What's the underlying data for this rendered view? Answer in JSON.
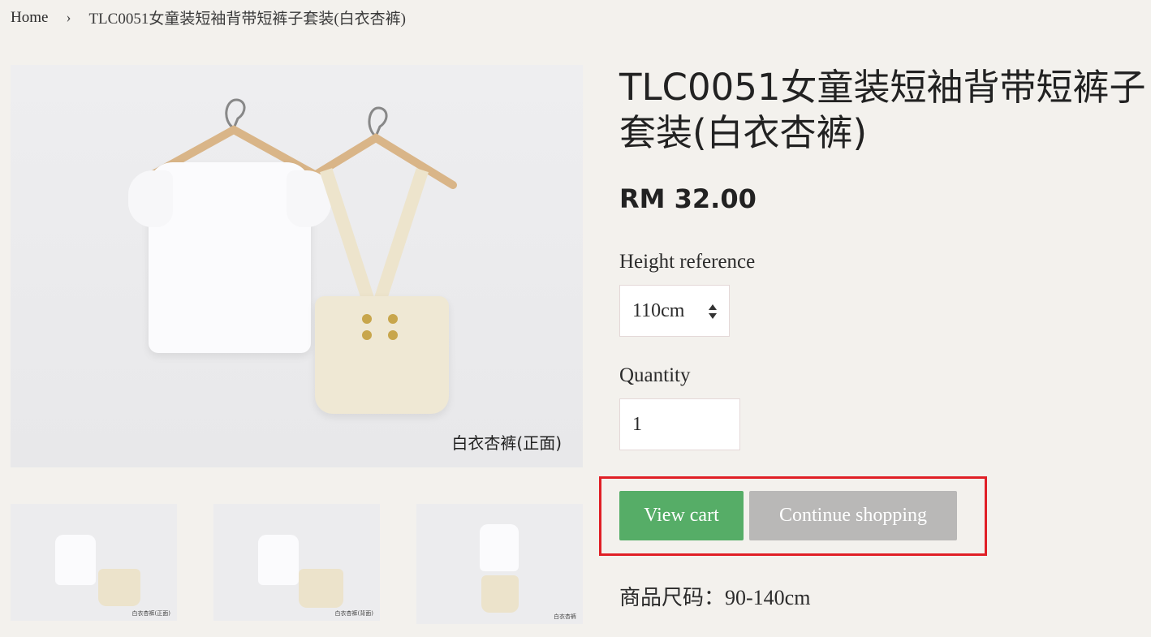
{
  "breadcrumb": {
    "home": "Home",
    "separator": "›",
    "current": "TLC0051女童装短袖背带短裤子套装(白衣杏裤)"
  },
  "gallery": {
    "main_caption": "白衣杏裤(正面)",
    "thumbnails": [
      {
        "caption": "白衣杏裤(正面)"
      },
      {
        "caption": "白衣杏裤(背面)"
      },
      {
        "caption": "白衣杏裤"
      }
    ]
  },
  "product": {
    "title_line1": "TLC0051女童装短袖背带短裤子",
    "title_line2": "套装(白衣杏裤)",
    "price": "RM 32.00"
  },
  "options": {
    "height_label": "Height reference",
    "height_value": "110cm",
    "quantity_label": "Quantity",
    "quantity_value": "1"
  },
  "actions": {
    "view_cart": "View cart",
    "continue_shopping": "Continue shopping"
  },
  "details": {
    "size_range": "商品尺码：90-140cm"
  },
  "colors": {
    "view_cart_bg": "#56ad67",
    "continue_bg": "#b9b8b7",
    "highlight_border": "#e01f26",
    "page_bg": "#f3f1ed"
  }
}
